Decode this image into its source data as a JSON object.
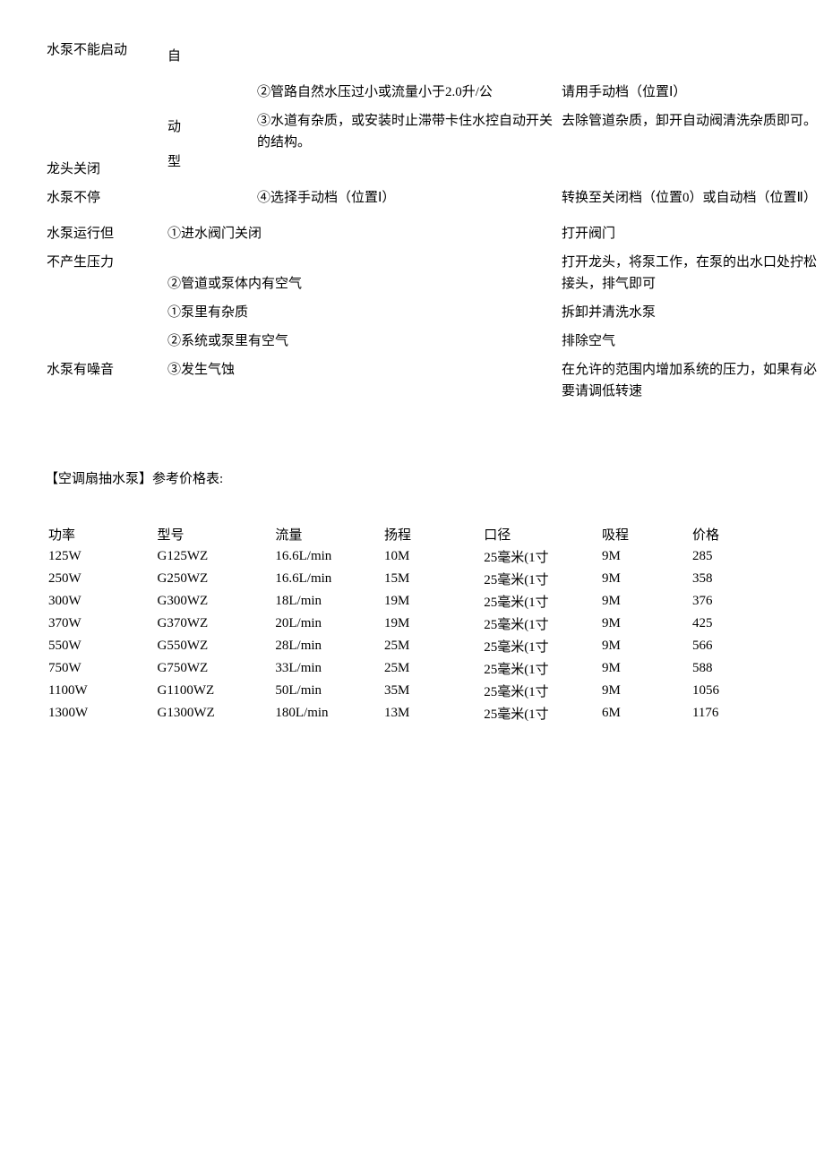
{
  "troubleshoot": {
    "col1": {
      "r1": "水泵不能启动",
      "r2": "龙头关闭",
      "r3": "水泵不停",
      "r4": "水泵运行但",
      "r5": "不产生压力",
      "r6": "水泵有噪音"
    },
    "col2": {
      "top": "自",
      "mid": "动",
      "bot": "型",
      "r4": "①进水阀门关闭",
      "r5": "②管道或泵体内有空气",
      "r6": "①泵里有杂质",
      "r7": "②系统或泵里有空气",
      "r8": "③发生气蚀"
    },
    "col3": {
      "r2": "②管路自然水压过小或流量小于2.0升/公",
      "r3": "③水道有杂质，或安装时止滞带卡住水控自动开关的结构。",
      "r4": "④选择手动档（位置Ⅰ）"
    },
    "col4": {
      "r2": "请用手动档（位置Ⅰ）",
      "r3": "去除管道杂质，卸开自动阀清洗杂质即可。",
      "r4": "转换至关闭档（位置0）或自动档（位置Ⅱ）",
      "r5": "打开阀门",
      "r6": "打开龙头，将泵工作，在泵的出水口处拧松接头，排气即可",
      "r7": "拆卸并清洗水泵",
      "r8": "排除空气",
      "r9": "在允许的范围内增加系统的压力，如果有必要请调低转速"
    }
  },
  "section_title": "【空调扇抽水泵】参考价格表:",
  "prices": {
    "headers": [
      "功率",
      "型号",
      "流量",
      "扬程",
      "口径",
      "吸程",
      "价格"
    ],
    "rows": [
      [
        "125W",
        "G125WZ",
        "16.6L/min",
        "10M",
        "25毫米(1寸",
        "9M",
        "285"
      ],
      [
        "250W",
        "G250WZ",
        "16.6L/min",
        "15M",
        "25毫米(1寸",
        "9M",
        "358"
      ],
      [
        "300W",
        "G300WZ",
        "18L/min",
        "19M",
        "25毫米(1寸",
        "9M",
        "376"
      ],
      [
        "370W",
        "G370WZ",
        "20L/min",
        "19M",
        "25毫米(1寸",
        "9M",
        "425"
      ],
      [
        "550W",
        "G550WZ",
        "28L/min",
        "25M",
        "25毫米(1寸",
        "9M",
        "566"
      ],
      [
        "750W",
        "G750WZ",
        "33L/min",
        "25M",
        "25毫米(1寸",
        "9M",
        "588"
      ],
      [
        "1100W",
        "G1100WZ",
        "50L/min",
        "35M",
        "25毫米(1寸",
        "9M",
        "1056"
      ],
      [
        "1300W",
        "G1300WZ",
        "180L/min",
        "13M",
        "25毫米(1寸",
        "6M",
        "1176"
      ]
    ]
  }
}
